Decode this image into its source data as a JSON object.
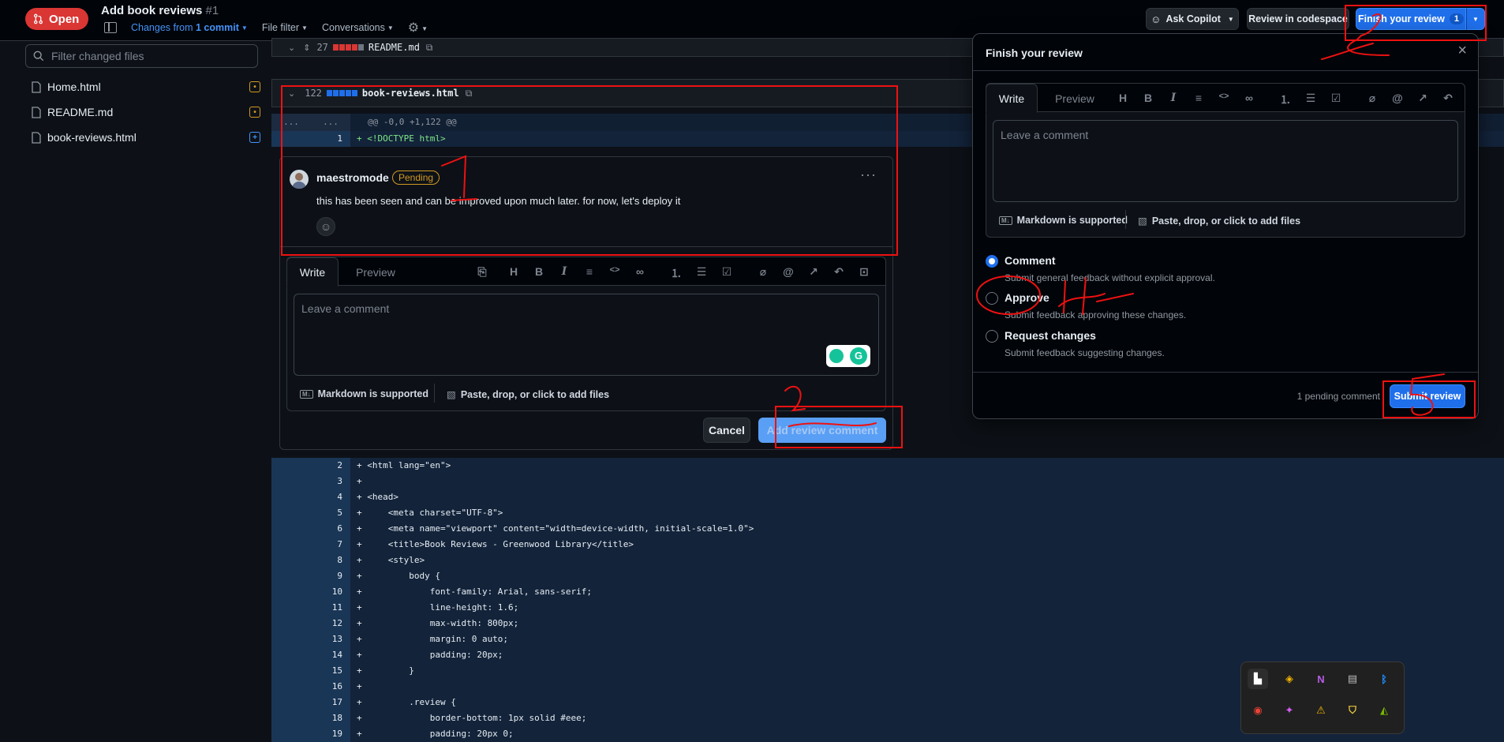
{
  "header": {
    "status_badge": "Open",
    "pr_title": "Add book reviews",
    "pr_number": "#1",
    "changes_prefix": "Changes from",
    "changes_value": "1 commit",
    "file_filter": "File filter",
    "conversations": "Conversations",
    "ask_copilot": "Ask Copilot",
    "review_codespace": "Review in codespace",
    "finish_review": "Finish your review",
    "finish_review_count": "1"
  },
  "sidebar": {
    "filter_placeholder": "Filter changed files",
    "files": [
      {
        "name": "Home.html",
        "status": "modified"
      },
      {
        "name": "README.md",
        "status": "modified"
      },
      {
        "name": "book-reviews.html",
        "status": "added"
      }
    ]
  },
  "diff": {
    "readme_header": {
      "count": "27",
      "name": "README.md"
    },
    "book_header": {
      "count": "122",
      "name": "book-reviews.html"
    },
    "hunk_left": "...",
    "hunk_right": "...",
    "hunk_text": "@@ -0,0 +1,122 @@",
    "line1": {
      "num": "1",
      "text": "+ <!DOCTYPE html>"
    },
    "lines": [
      {
        "num": "2",
        "text": "+ <html lang=\"en\">"
      },
      {
        "num": "3",
        "text": "+"
      },
      {
        "num": "4",
        "text": "+ <head>"
      },
      {
        "num": "5",
        "text": "+     <meta charset=\"UTF-8\">"
      },
      {
        "num": "6",
        "text": "+     <meta name=\"viewport\" content=\"width=device-width, initial-scale=1.0\">"
      },
      {
        "num": "7",
        "text": "+     <title>Book Reviews - Greenwood Library</title>"
      },
      {
        "num": "8",
        "text": "+     <style>"
      },
      {
        "num": "9",
        "text": "+         body {"
      },
      {
        "num": "10",
        "text": "+             font-family: Arial, sans-serif;"
      },
      {
        "num": "11",
        "text": "+             line-height: 1.6;"
      },
      {
        "num": "12",
        "text": "+             max-width: 800px;"
      },
      {
        "num": "13",
        "text": "+             margin: 0 auto;"
      },
      {
        "num": "14",
        "text": "+             padding: 20px;"
      },
      {
        "num": "15",
        "text": "+         }"
      },
      {
        "num": "16",
        "text": "+"
      },
      {
        "num": "17",
        "text": "+         .review {"
      },
      {
        "num": "18",
        "text": "+             border-bottom: 1px solid #eee;"
      },
      {
        "num": "19",
        "text": "+             padding: 20px 0;"
      }
    ]
  },
  "comment": {
    "author": "maestromode",
    "state": "Pending",
    "body": "this has been seen and can be improved upon much later. for now, let's deploy it"
  },
  "reply_editor": {
    "tab_write": "Write",
    "tab_preview": "Preview",
    "placeholder": "Leave a comment",
    "markdown": "Markdown is supported",
    "attach": "Paste, drop, or click to add files",
    "cancel": "Cancel",
    "add_review": "Add review comment"
  },
  "review_popover": {
    "title": "Finish your review",
    "tab_write": "Write",
    "tab_preview": "Preview",
    "placeholder": "Leave a comment",
    "markdown": "Markdown is supported",
    "attach": "Paste, drop, or click to add files",
    "options": [
      {
        "label": "Comment",
        "desc": "Submit general feedback without explicit approval.",
        "selected": true
      },
      {
        "label": "Approve",
        "desc": "Submit feedback approving these changes.",
        "selected": false
      },
      {
        "label": "Request changes",
        "desc": "Submit feedback suggesting changes.",
        "selected": false
      }
    ],
    "pending": "1 pending comment",
    "submit": "Submit review"
  },
  "colors": {
    "accent": "#1f6feb",
    "danger": "#da3633",
    "pending": "#d29922",
    "annotation": "#ee1111"
  }
}
